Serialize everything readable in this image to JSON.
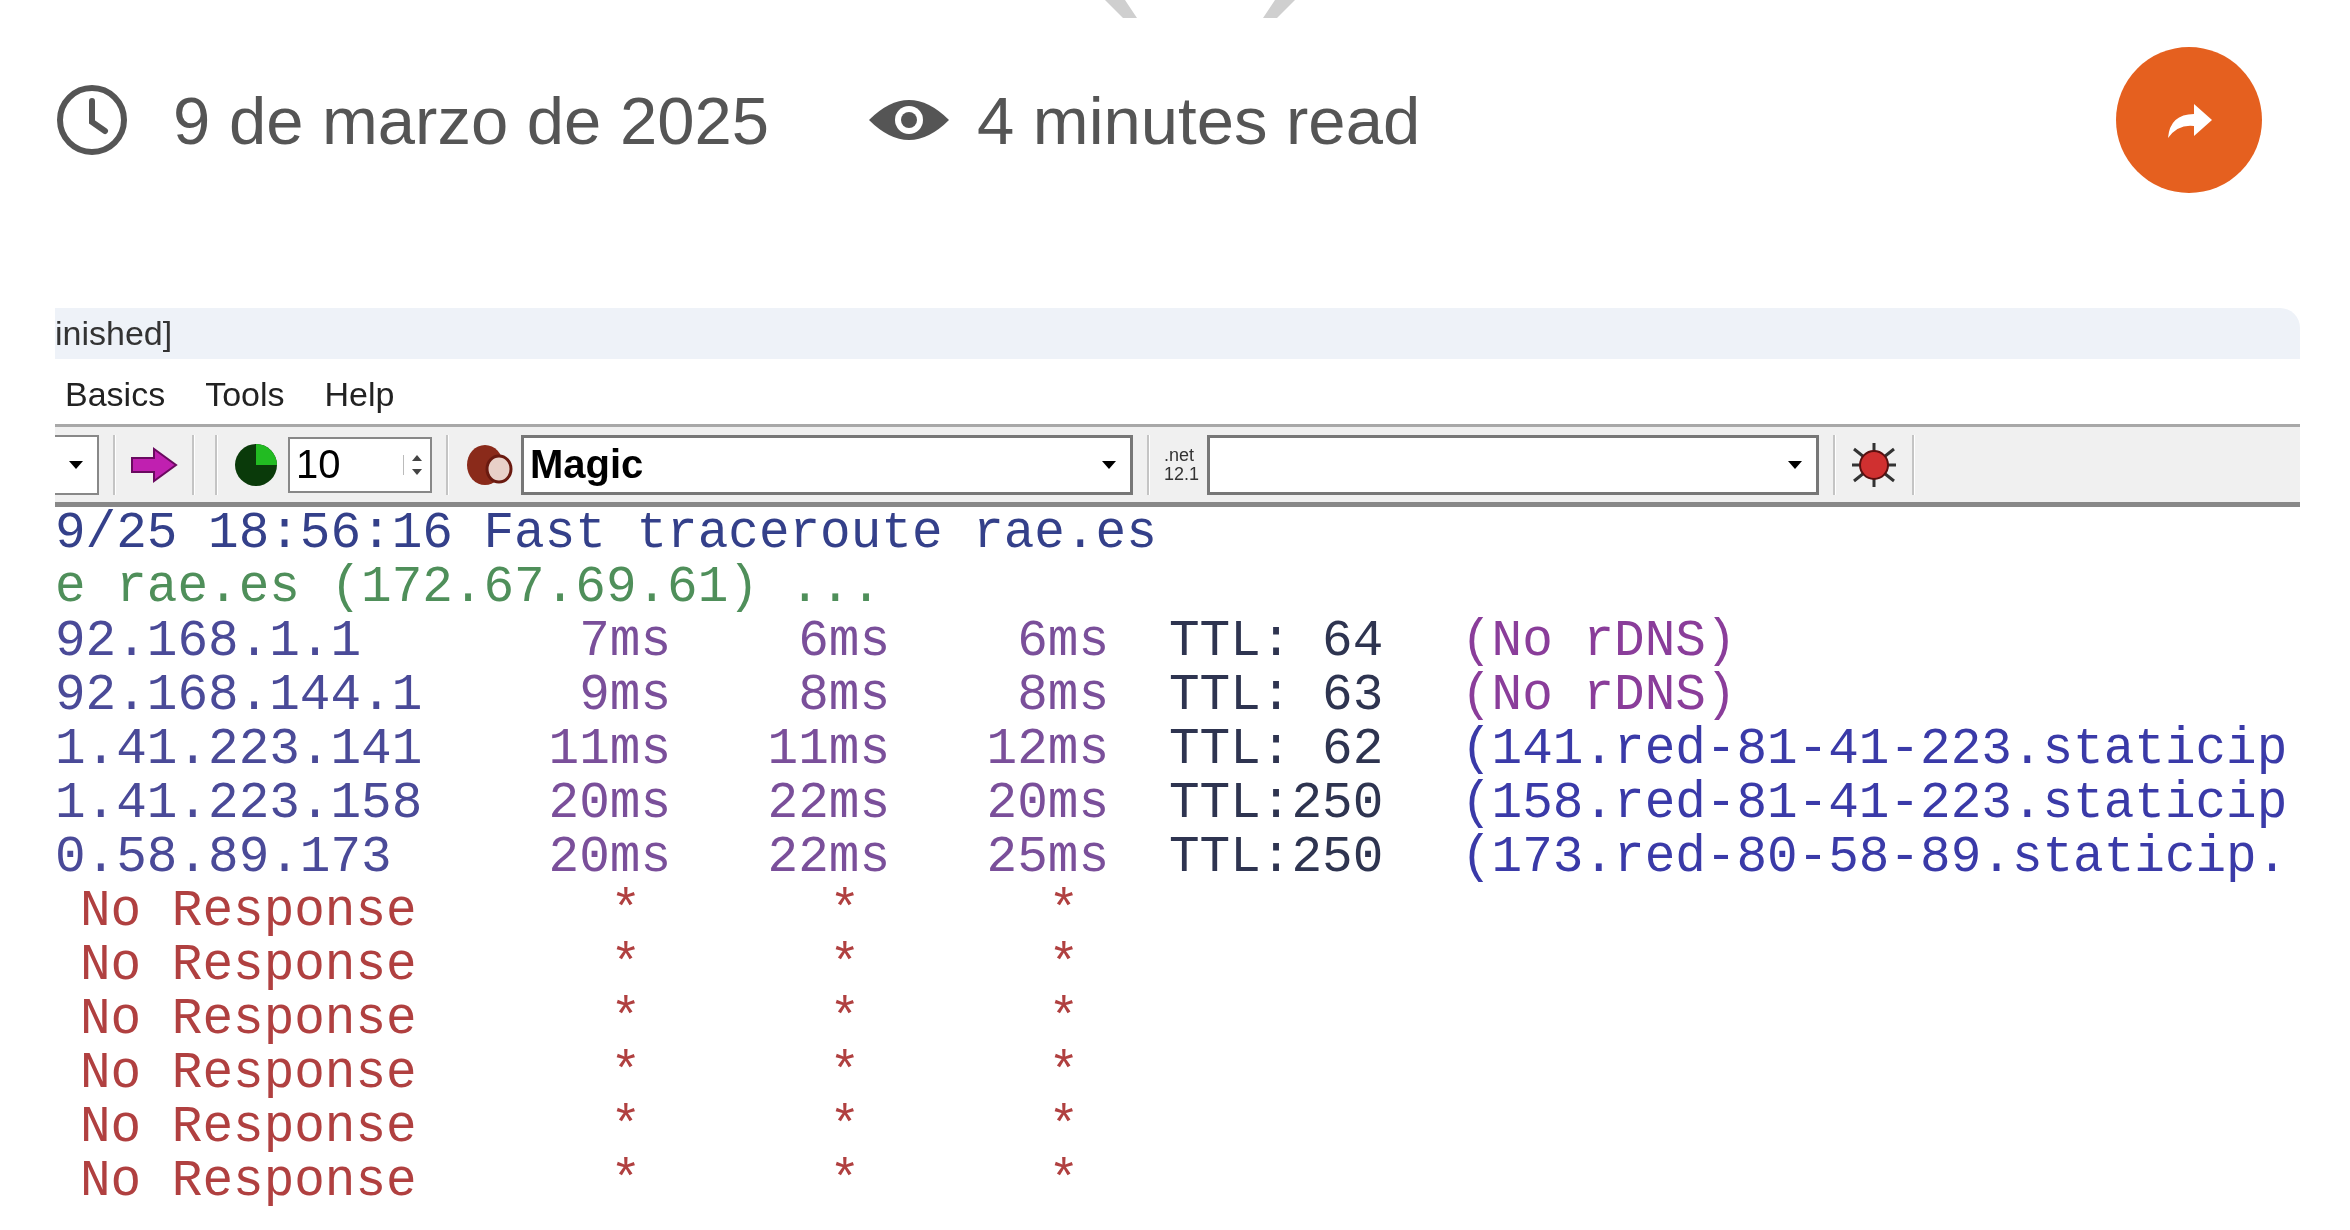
{
  "meta": {
    "date": "9 de marzo de 2025",
    "read_time": "4 minutes read"
  },
  "app": {
    "title": "inished]",
    "menu": [
      "Basics",
      "Tools",
      "Help"
    ],
    "toolbar": {
      "count": "10",
      "mode": "Magic",
      "net_icon": [
        ".net",
        "12.1"
      ]
    },
    "log": [
      {
        "kind": "header",
        "text": "9/25 18:56:16 Fast traceroute rae.es"
      },
      {
        "kind": "status",
        "text": "e rae.es (172.67.69.61) ..."
      },
      {
        "kind": "hop",
        "ip": "92.168.1.1",
        "times": [
          "7ms",
          "6ms",
          "6ms"
        ],
        "ttl": "TTL: 64",
        "dns": "(No rDNS)",
        "dns_found": false
      },
      {
        "kind": "hop",
        "ip": "92.168.144.1",
        "times": [
          "9ms",
          "8ms",
          "8ms"
        ],
        "ttl": "TTL: 63",
        "dns": "(No rDNS)",
        "dns_found": false
      },
      {
        "kind": "hop",
        "ip": "1.41.223.141",
        "times": [
          "11ms",
          "11ms",
          "12ms"
        ],
        "ttl": "TTL: 62",
        "dns": "(141.red-81-41-223.staticip",
        "dns_found": true
      },
      {
        "kind": "hop",
        "ip": "1.41.223.158",
        "times": [
          "20ms",
          "22ms",
          "20ms"
        ],
        "ttl": "TTL:250",
        "dns": "(158.red-81-41-223.staticip",
        "dns_found": true
      },
      {
        "kind": "hop",
        "ip": "0.58.89.173",
        "times": [
          "20ms",
          "22ms",
          "25ms"
        ],
        "ttl": "TTL:250",
        "dns": "(173.red-80-58-89.staticip.",
        "dns_found": true
      },
      {
        "kind": "timeout",
        "label": "No Response",
        "times": [
          "*",
          "*",
          "*"
        ]
      },
      {
        "kind": "timeout",
        "label": "No Response",
        "times": [
          "*",
          "*",
          "*"
        ]
      },
      {
        "kind": "timeout",
        "label": "No Response",
        "times": [
          "*",
          "*",
          "*"
        ]
      },
      {
        "kind": "timeout",
        "label": "No Response",
        "times": [
          "*",
          "*",
          "*"
        ]
      },
      {
        "kind": "timeout",
        "label": "No Response",
        "times": [
          "*",
          "*",
          "*"
        ]
      },
      {
        "kind": "timeout",
        "label": "No Response",
        "times": [
          "*",
          "*",
          "*"
        ]
      }
    ]
  }
}
